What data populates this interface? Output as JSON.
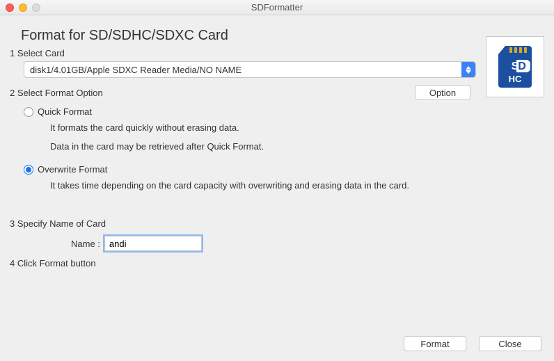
{
  "window": {
    "title": "SDFormatter"
  },
  "heading": "Format for SD/SDHC/SDXC Card",
  "steps": {
    "s1": "1 Select Card",
    "s2": "2 Select Format Option",
    "s3": "3 Specify Name of Card",
    "s4": "4 Click Format button"
  },
  "card_select": {
    "value": "disk1/4.01GB/Apple SDXC Reader Media/NO NAME"
  },
  "option_button": "Option",
  "format_options": {
    "quick": {
      "label": "Quick Format",
      "desc1": "It formats the card quickly without erasing data.",
      "desc2": "Data in the card may be retrieved after Quick Format.",
      "selected": false
    },
    "overwrite": {
      "label": "Overwrite Format",
      "desc1": "It takes time depending on the card capacity with overwriting and erasing data in the card.",
      "selected": true
    }
  },
  "name_field": {
    "label": "Name :",
    "value": "andi"
  },
  "buttons": {
    "format": "Format",
    "close": "Close"
  },
  "logo_alt": "SDHC"
}
